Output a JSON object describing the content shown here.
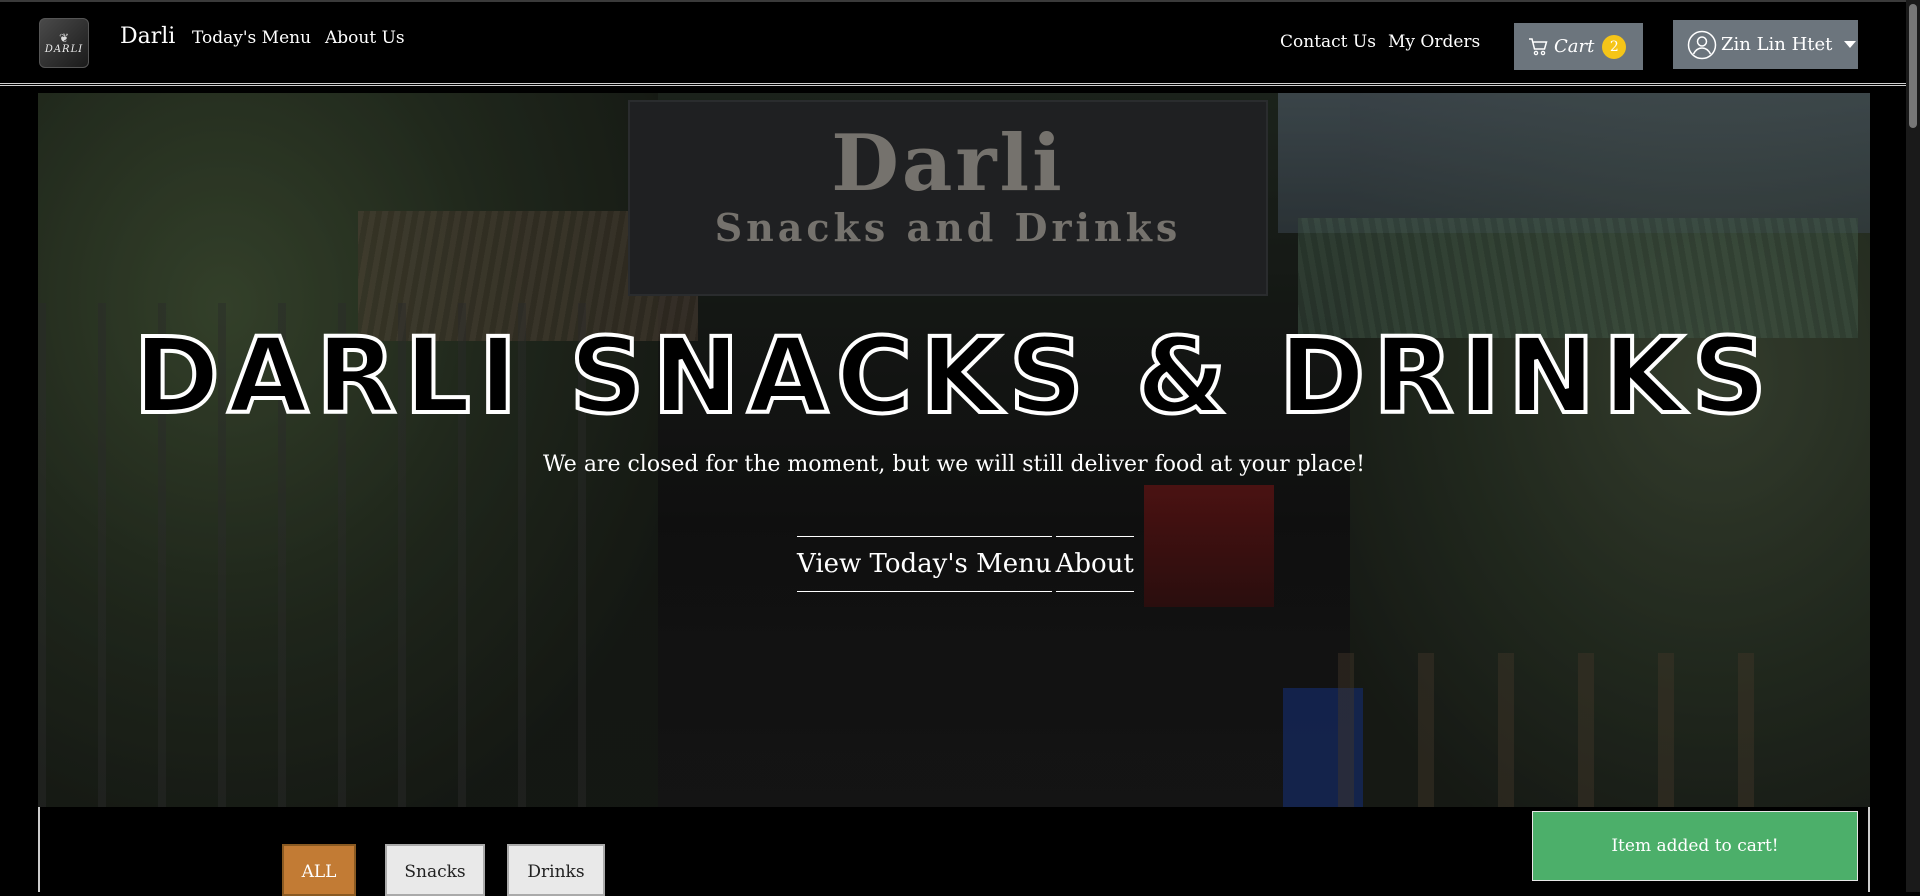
{
  "navbar": {
    "logo_text": "DARLI",
    "brand": "Darli",
    "links": {
      "todays_menu": "Today's Menu",
      "about_us": "About Us",
      "contact_us": "Contact Us",
      "my_orders": "My Orders"
    },
    "cart": {
      "label": "Cart",
      "count": "2",
      "badge_color": "#f5c518"
    },
    "user": {
      "name": "Zin Lin Htet"
    }
  },
  "hero": {
    "sign_title": "Darli",
    "sign_subtitle": "Snacks and Drinks",
    "title": "DARLI SNACKS & DRINKS",
    "subtitle": "We are closed for the moment, but we will still deliver food at your place!",
    "buttons": {
      "view_menu": "View Today's Menu",
      "about": "About"
    }
  },
  "filters": {
    "items": [
      "ALL",
      "Snacks",
      "Drinks"
    ],
    "active": "ALL",
    "active_color": "#c27b34"
  },
  "toast": {
    "message": "Item added to cart!",
    "color": "#4caf6a"
  }
}
